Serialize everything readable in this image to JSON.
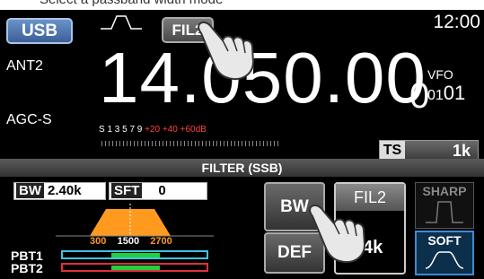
{
  "caption": "Select a passband width mode",
  "header": {
    "mode_label": "USB",
    "filter_label": "FIL2",
    "clock": "12:00"
  },
  "main": {
    "antenna": "ANT2",
    "agc": "AGC-S",
    "frequency_main": "14.050.00",
    "frequency_last": "0",
    "vfo_label": "VFO",
    "vfo_small": "01",
    "vfo_big": "01"
  },
  "meter": {
    "white_scale": "S 1 3 5 7 9",
    "red_scale": "+20 +40 +60dB"
  },
  "ts": {
    "label": "TS",
    "value": "1k"
  },
  "filter_panel": {
    "title": "FILTER (SSB)",
    "bw_tag": "BW",
    "bw_value": "2.40k",
    "sft_tag": "SFT",
    "sft_value": "0",
    "low_freq": "300",
    "center_freq": "1500",
    "high_freq": "2700",
    "pbt1_label": "PBT1",
    "pbt2_label": "PBT2",
    "pbt1_color": "#3fc3e0",
    "pbt2_color": "#e0303a",
    "bw_button": "BW",
    "def_button": "DEF",
    "fil2_button": "FIL2",
    "fil2_value": "4k",
    "sharp_button": "SHARP",
    "soft_button": "SOFT"
  },
  "colors": {
    "accent_blue": "#4a6fa8",
    "passband": "#ff9a1f",
    "soft_selected": "#3f8ad3"
  },
  "icons": [
    "filter-shape-icon",
    "pointing-hand-icon"
  ]
}
